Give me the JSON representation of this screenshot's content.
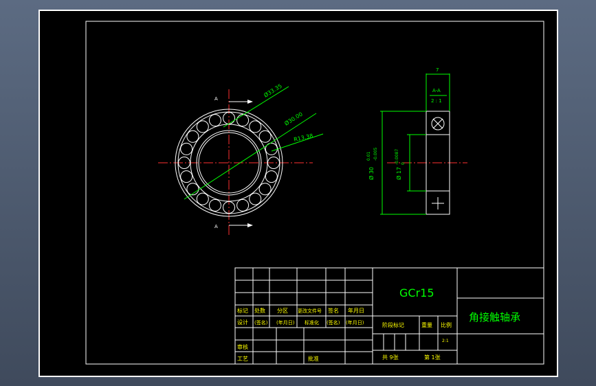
{
  "colors": {
    "background": "#000000",
    "border": "#ffffff",
    "dimension": "#00ff00",
    "center_line": "#ff3030",
    "text_yellow": "#ffff00",
    "title_text": "#00ff00"
  },
  "section_label_left_top": "A",
  "section_label_left_bottom": "A",
  "dimensions": {
    "d1": "Ø33.35",
    "d2": "Ø30.00",
    "r": "R13.38",
    "width": "7",
    "outer": "Ø 30",
    "outer_tol_upper": "0.01",
    "outer_tol_lower": "-0.005",
    "inner": "Ø 17",
    "inner_tol": "-0.0087",
    "inner_tol2": "0"
  },
  "section_view": {
    "title": "A-A",
    "scale": "2 : 1"
  },
  "title_block": {
    "material": "GCr15",
    "part_name": "角接触轴承",
    "row_labels": [
      "标记",
      "处数",
      "分区",
      "更改文件号",
      "签名",
      "年月日"
    ],
    "design_row": [
      "设计",
      "(签名)",
      "(年月日)",
      "标准化",
      "(签名)",
      "(年月日)"
    ],
    "review": "审核",
    "process": "工艺",
    "approve": "批准",
    "stage_mark": "阶段标记",
    "weight": "重量",
    "scale_label": "比例",
    "scale_value": "2:1",
    "sheets_total": "共 9张",
    "sheet_no": "第 1张"
  }
}
